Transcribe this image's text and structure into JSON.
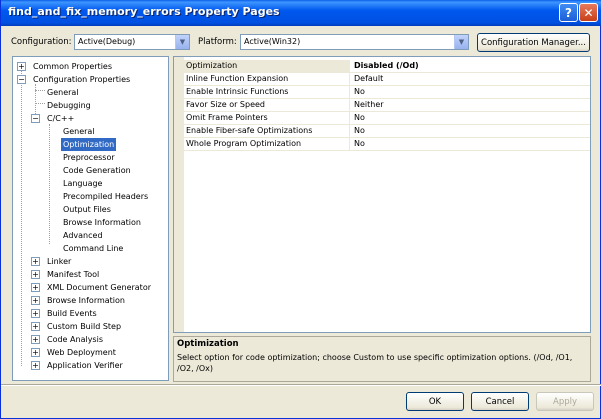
{
  "window": {
    "title": "find_and_fix_memory_errors Property Pages",
    "help_glyph": "?",
    "close_glyph": "✕"
  },
  "toolbar": {
    "configuration_label": "Configuration:",
    "configuration_value": "Active(Debug)",
    "platform_label": "Platform:",
    "platform_value": "Active(Win32)",
    "config_manager_label": "Configuration Manager...",
    "dropdown_glyph": "▼"
  },
  "tree": {
    "common_properties": "Common Properties",
    "configuration_properties": "Configuration Properties",
    "general": "General",
    "debugging": "Debugging",
    "cpp": "C/C++",
    "cpp_children": [
      "General",
      "Optimization",
      "Preprocessor",
      "Code Generation",
      "Language",
      "Precompiled Headers",
      "Output Files",
      "Browse Information",
      "Advanced",
      "Command Line"
    ],
    "collapsed": [
      "Linker",
      "Manifest Tool",
      "XML Document Generator",
      "Browse Information",
      "Build Events",
      "Custom Build Step",
      "Code Analysis",
      "Web Deployment",
      "Application Verifier"
    ],
    "plus": "+",
    "minus": "−"
  },
  "grid": {
    "rows": [
      {
        "name": "Optimization",
        "value": "Disabled (/Od)"
      },
      {
        "name": "Inline Function Expansion",
        "value": "Default"
      },
      {
        "name": "Enable Intrinsic Functions",
        "value": "No"
      },
      {
        "name": "Favor Size or Speed",
        "value": "Neither"
      },
      {
        "name": "Omit Frame Pointers",
        "value": "No"
      },
      {
        "name": "Enable Fiber-safe Optimizations",
        "value": "No"
      },
      {
        "name": "Whole Program Optimization",
        "value": "No"
      }
    ]
  },
  "description": {
    "title": "Optimization",
    "text": "Select option for code optimization; choose Custom to use specific optimization options.      (/Od, /O1, /O2, /Ox)"
  },
  "buttons": {
    "ok": "OK",
    "cancel": "Cancel",
    "apply": "Apply"
  }
}
